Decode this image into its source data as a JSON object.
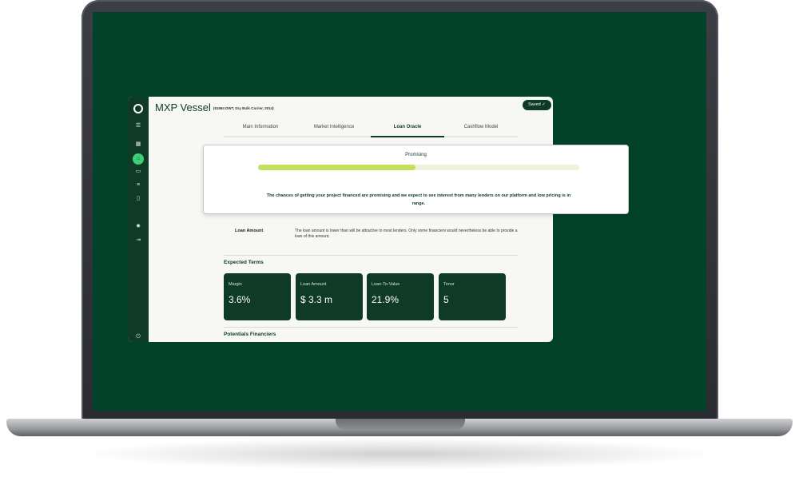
{
  "app": {
    "title": "MXP Vessel",
    "subtitle": "(81864 DWT, Dry Bulk Carrier, 2014)",
    "saved_label": "Saved ✓"
  },
  "tabs": [
    {
      "label": "Main Information",
      "active": false
    },
    {
      "label": "Market Intelligence",
      "active": false
    },
    {
      "label": "Loan Oracle",
      "active": true
    },
    {
      "label": "Cashflow Model",
      "active": false
    }
  ],
  "oracle": {
    "status": "Promising",
    "progress_fraction": 0.49,
    "message": "The chances of getting your project financed are promising and we expect to see interest from many lenders on our platform and low pricing is in range."
  },
  "loan_amount": {
    "label": "Loan Amount",
    "text": "The loan amount is lower than will be attractive to most lenders. Only some financiers would nevertheless be able to provide a loan of this amount."
  },
  "expected_terms": {
    "title": "Expected Terms",
    "cards": [
      {
        "label": "Margin",
        "value": "3.6%"
      },
      {
        "label": "Loan Amount",
        "value": "$ 3.3 m"
      },
      {
        "label": "Loan-To-Value",
        "value": "21.9%"
      },
      {
        "label": "Tenor",
        "value": "5"
      }
    ]
  },
  "financiers": {
    "title": "Potentials Financiers"
  },
  "sidebar": {
    "icons": [
      "logo-icon",
      "menu-icon",
      "grid-icon",
      "home-icon",
      "chart-icon",
      "list-icon",
      "document-icon",
      "settings-icon",
      "logout-icon",
      "power-icon"
    ]
  },
  "colors": {
    "brand": "#0f3a25",
    "screen_bg": "#03422a",
    "progress": "#c3e15d",
    "active_icon": "#3fce7a"
  }
}
